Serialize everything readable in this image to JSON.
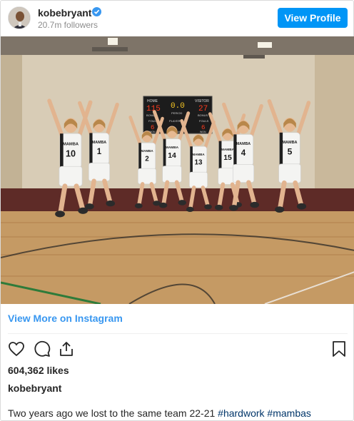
{
  "header": {
    "username": "kobebryant",
    "followers": "20.7m followers",
    "view_profile_label": "View Profile"
  },
  "post": {
    "photo": {
      "scoreboard": {
        "home_label": "HOME",
        "visitor_label": "VISITOR",
        "home_score": "115",
        "visitor_score": "27",
        "clock": "0.0",
        "period_label": "PERIOD",
        "fouls_label": "FOULS",
        "player_label": "PLAYER",
        "home_fouls": "6",
        "visitor_fouls": "6",
        "bonus_label": "BONUS",
        "game_label": "GAME",
        "won_label": "WON"
      },
      "players": [
        {
          "number": "10",
          "team": "MAMBA"
        },
        {
          "number": "1",
          "team": "MAMBA"
        },
        {
          "number": "2",
          "team": "MAMBA"
        },
        {
          "number": "14",
          "team": "MAMBA"
        },
        {
          "number": "13",
          "team": "MAMBA"
        },
        {
          "number": "15",
          "team": "MAMBA"
        },
        {
          "number": "4",
          "team": "MAMBA"
        },
        {
          "number": "5",
          "team": "MAMBA"
        }
      ]
    },
    "view_more_label": "View More on Instagram",
    "likes": "604,362 likes",
    "owner": "kobebryant",
    "caption_text": "Two years ago we lost to the same team 22-21 ",
    "caption_tags": [
      "#hardwork",
      "#mambas"
    ]
  },
  "colors": {
    "accent": "#0095f6",
    "link": "#3897f0",
    "hashtag": "#003569",
    "scoreboard_digits": "#ff3b1f",
    "jersey": "#f4f4f2"
  },
  "icons": [
    "verified-badge-icon",
    "heart-icon",
    "comment-icon",
    "share-icon",
    "bookmark-icon"
  ]
}
